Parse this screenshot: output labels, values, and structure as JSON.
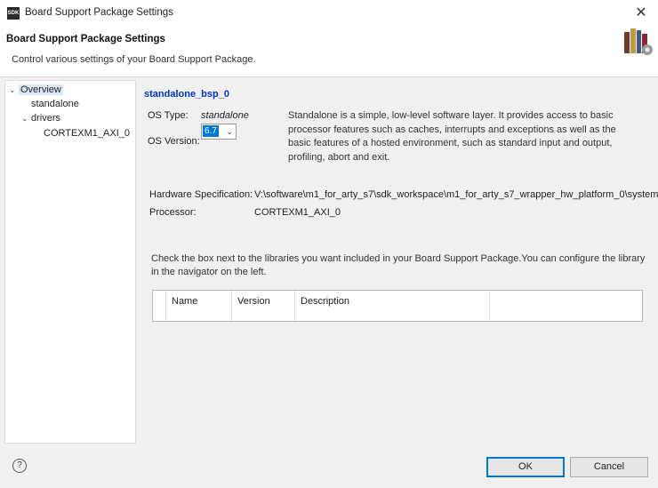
{
  "window": {
    "title": "Board Support Package Settings",
    "app_icon_text": "SDK",
    "close_label": "✕"
  },
  "header": {
    "title": "Board Support Package Settings",
    "description": "Control various settings of your Board Support Package.",
    "graphic_icon": "library-books-icon"
  },
  "nav": {
    "items": [
      {
        "label": "Overview",
        "expanded": true,
        "selected": true
      },
      {
        "label": "standalone"
      },
      {
        "label": "drivers",
        "expanded": true
      },
      {
        "label": "CORTEXM1_AXI_0"
      }
    ]
  },
  "content": {
    "bsp_name": "standalone_bsp_0",
    "os_type_label": "OS Type:",
    "os_type_value": "standalone",
    "os_version_label": "OS Version:",
    "os_version_value": "6.7",
    "os_description": "Standalone is a simple, low-level software layer. It provides access to basic processor features such as caches, interrupts and exceptions as well as the basic features of a hosted environment, such as standard input and output, profiling, abort and exit.",
    "hw_spec_label": "Hardware Specification:",
    "hw_spec_value": "V:\\software\\m1_for_arty_s7\\sdk_workspace\\m1_for_arty_s7_wrapper_hw_platform_0\\system",
    "processor_label": "Processor:",
    "processor_value": "CORTEXM1_AXI_0",
    "libraries_text": "Check the box next to the libraries you want included in your Board Support Package.You can configure the library in the navigator on the left.",
    "table_columns": [
      "",
      "Name",
      "Version",
      "Description",
      ""
    ]
  },
  "footer": {
    "ok_label": "OK",
    "cancel_label": "Cancel",
    "help_label": "?"
  },
  "colors": {
    "accent": "#0078d7",
    "bsp_name": "#0033cc",
    "selection": "#dbe7f5"
  }
}
